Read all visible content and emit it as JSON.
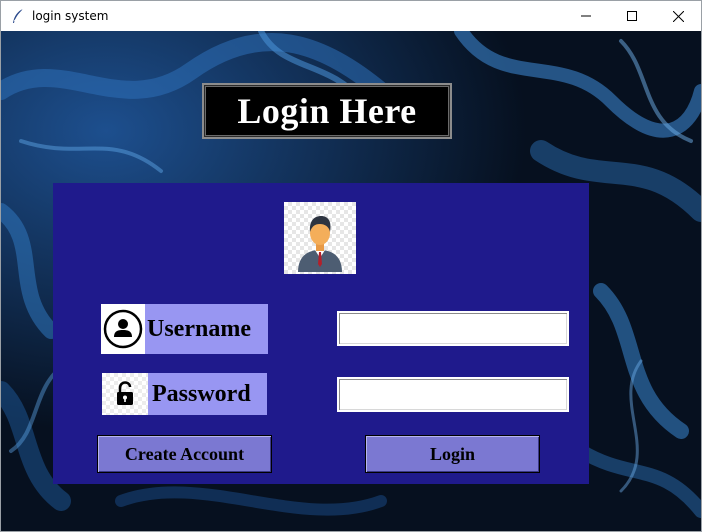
{
  "window": {
    "title": "login system"
  },
  "login": {
    "heading": "Login Here",
    "username_label": "Username",
    "password_label": "Password",
    "username_value": "",
    "password_value": "",
    "create_account_label": "Create Account",
    "login_label": "Login"
  },
  "colors": {
    "panel": "#1f1a8c",
    "label_bg": "#9896f2",
    "button_bg": "#7b78d2",
    "heading_bg": "#000000"
  },
  "icons": {
    "app": "feather-icon",
    "avatar": "person-avatar-icon",
    "username": "user-circle-icon",
    "password": "padlock-icon"
  }
}
